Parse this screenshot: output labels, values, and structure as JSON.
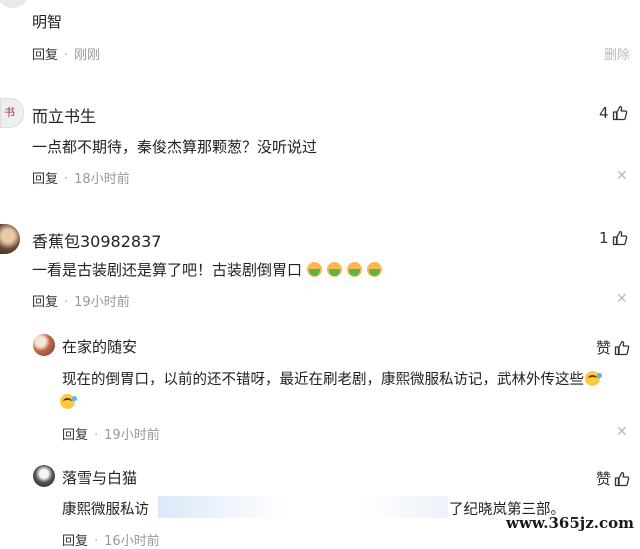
{
  "comments": [
    {
      "text": "明智",
      "time": "刚刚",
      "reply_label": "回复",
      "delete_label": "删除"
    },
    {
      "user": "而立书生",
      "avatar_text": "书",
      "text": "一点都不期待，秦俊杰算那颗葱？没听说过",
      "time": "18小时前",
      "reply_label": "回复",
      "likes": "4"
    },
    {
      "user": "香蕉包30982837",
      "text": "一看是古装剧还是算了吧！古装剧倒胃口",
      "emoji": [
        "sick-face",
        "sick-face",
        "sick-face",
        "sick-face"
      ],
      "time": "19小时前",
      "reply_label": "回复",
      "likes": "1"
    }
  ],
  "replies": [
    {
      "user": "在家的随安",
      "text_line1": "现在的倒胃口，以前的还不错呀，最近在刷老剧，康熙微服私访记，武林外传这些",
      "emoji": [
        "laugh-tears",
        "laugh-tears"
      ],
      "time": "19小时前",
      "reply_label": "回复",
      "likes_label": "赞"
    },
    {
      "user": "落雪与白猫",
      "text_start": "康熙微服私访",
      "text_end": "了纪晓岚第三部。",
      "time": "16小时前",
      "reply_label": "回复",
      "likes_label": "赞"
    }
  ],
  "watermark": "www.365jz.com",
  "colors": {
    "meta": "#999999",
    "text": "#222222"
  }
}
